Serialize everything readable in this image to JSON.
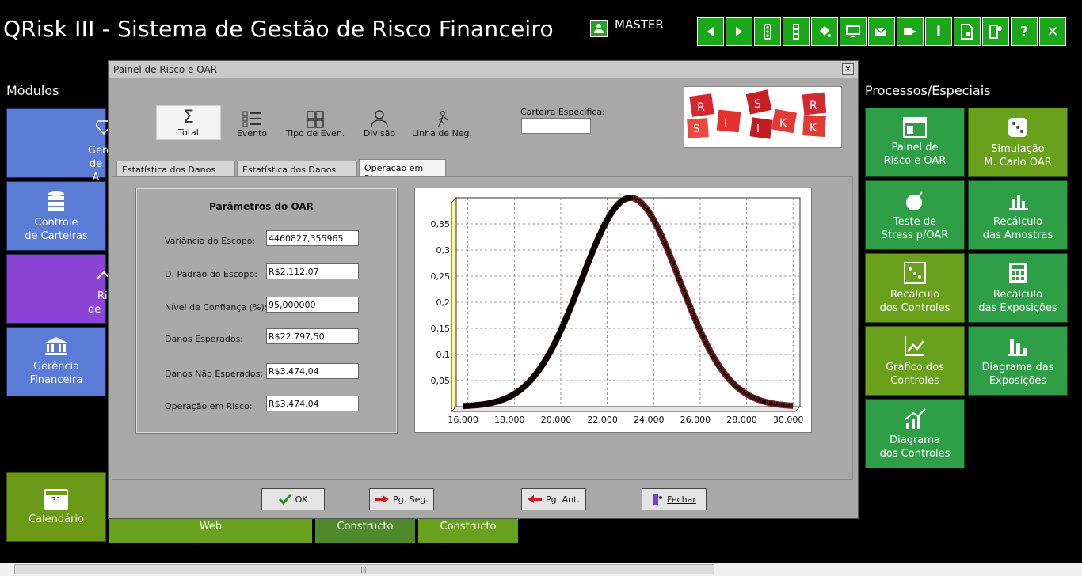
{
  "app": {
    "title": "QRisk III - Sistema de Gestão de Risco Financeiro",
    "user": "MASTER"
  },
  "toolbar": {
    "buttons": [
      "back",
      "forward",
      "traffic-light",
      "traffic-light-bar",
      "paint-bucket",
      "monitor",
      "mail",
      "send",
      "info",
      "document-settings",
      "exit-door",
      "help",
      "close"
    ],
    "info_glyph": "i",
    "help_glyph": "?",
    "close_glyph": "✕"
  },
  "sections": {
    "left": "Módulos",
    "right": "Processos/Especiais"
  },
  "left_tiles": [
    {
      "label1": "Gerênc",
      "label2": "de A",
      "icon": "diamond-icon"
    },
    {
      "label1": "Controle",
      "label2": "de Carteiras",
      "icon": "database-icon"
    },
    {
      "label1": "Risc",
      "label2": "de  C",
      "icon": "hands-icon"
    },
    {
      "label1": "Gerência",
      "label2": "Financeira",
      "icon": "bank-icon"
    }
  ],
  "calendar_tile": {
    "label": "Calendário",
    "day": "31"
  },
  "bottom_tiles": [
    "Web",
    "Constructo",
    "Constructo"
  ],
  "right_tiles": [
    {
      "label1": "Painel de",
      "label2": "Risco e OAR"
    },
    {
      "label1": "Simulação",
      "label2": "M. Carlo OAR"
    },
    {
      "label1": "Teste de",
      "label2": "Stress p/OAR"
    },
    {
      "label1": "Recálculo",
      "label2": "das Amostras"
    },
    {
      "label1": "Recálculo",
      "label2": "dos Controles"
    },
    {
      "label1": "Recálculo",
      "label2": "das Exposições"
    },
    {
      "label1": "Gráfico dos",
      "label2": "Controles"
    },
    {
      "label1": "Diagrama das",
      "label2": "Exposições"
    },
    {
      "label1": "Diagrama",
      "label2": "dos Controles"
    }
  ],
  "dialog": {
    "title": "Painel de Risco e OAR",
    "close": "×",
    "tools": {
      "total": "Total",
      "evento": "Evento",
      "tipo": "Tipo de Even.",
      "divisao": "Divisão",
      "linha": "Linha de Neg.",
      "sigma": "Σ"
    },
    "carteira_label": "Carteira Específica:",
    "carteira_value": "",
    "logo_letters": [
      "R",
      "I",
      "S",
      "K",
      "R",
      "I",
      "S",
      "K"
    ],
    "tabs": [
      "Estatística dos Danos (Tab.)",
      "Estatística dos Danos (Gráf.)",
      "Operação em Risco"
    ],
    "params": {
      "title": "Parâmetros do OAR",
      "rows": [
        {
          "label": "Variância do Escopo:",
          "value": "4460827,355965"
        },
        {
          "label": "D. Padrão do Escopo:",
          "value": "R$2.112,07"
        },
        {
          "label": "Nível de Confiança (%):",
          "value": "95,000000"
        },
        {
          "label": "Danos Esperados:",
          "value": "R$22.797,50"
        },
        {
          "label": "Danos Não Esperados:",
          "value": "R$3.474,04"
        },
        {
          "label": "Operação em Risco:",
          "value": "R$3.474,04"
        }
      ]
    },
    "buttons": {
      "ok": "OK",
      "next": "Pg. Seg.",
      "prev": "Pg. Ant.",
      "close": "Fechar"
    }
  },
  "chart_data": {
    "type": "area",
    "xlim": [
      15500,
      30300
    ],
    "ylim": [
      0,
      0.4
    ],
    "x_ticks": [
      "16.000",
      "18.000",
      "20.000",
      "22.000",
      "24.000",
      "26.000",
      "28.000",
      "30.000"
    ],
    "y_ticks": [
      "0,05",
      "0,1",
      "0,15",
      "0,2",
      "0,25",
      "0,3",
      "0,35"
    ],
    "series": [
      {
        "mean": 23000,
        "sd": 2112.07,
        "peak": 0.4
      }
    ],
    "grid": true,
    "title": "",
    "xlabel": "",
    "ylabel": ""
  }
}
